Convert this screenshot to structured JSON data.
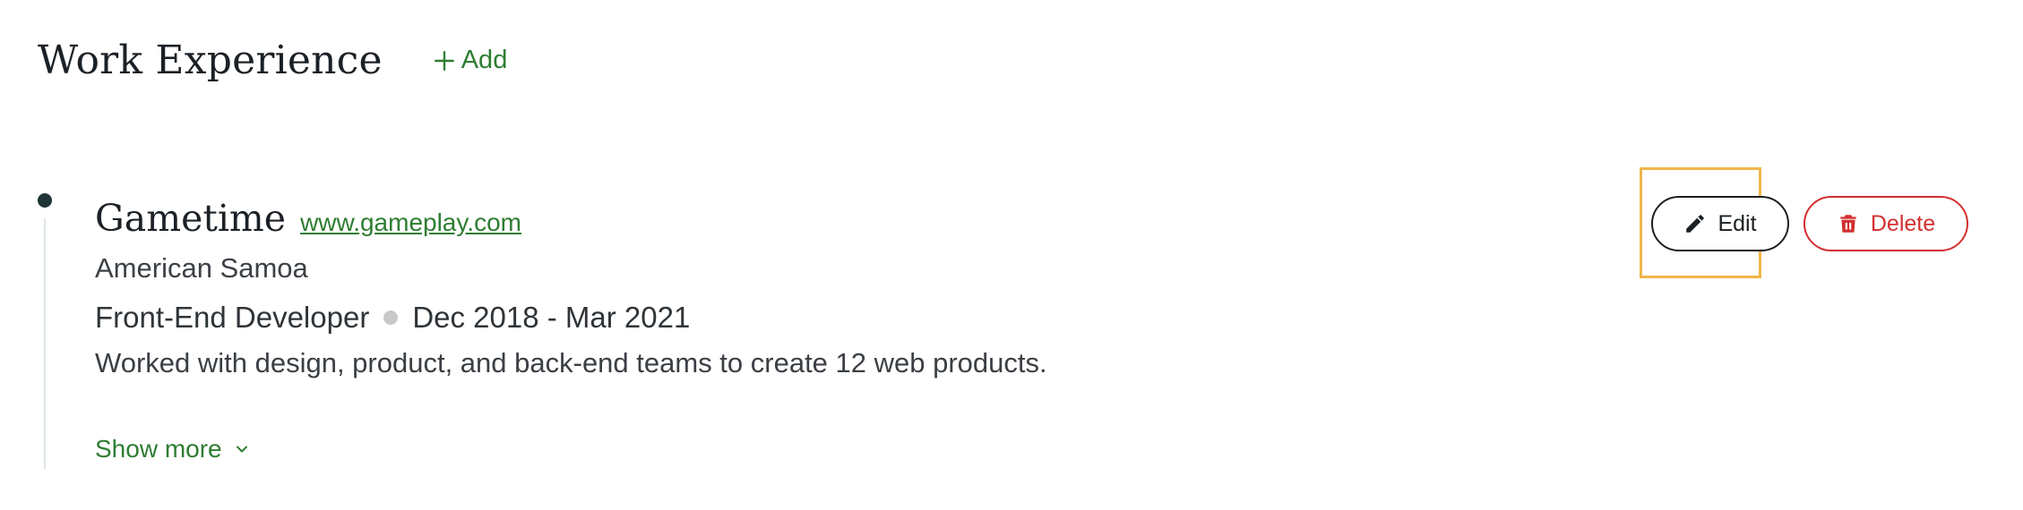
{
  "section": {
    "title": "Work Experience",
    "add_label": "Add"
  },
  "entry": {
    "company": "Gametime",
    "website": "www.gameplay.com",
    "location": "American Samoa",
    "role": "Front-End Developer",
    "dates": "Dec 2018 - Mar 2021",
    "description": "Worked with design, product, and back-end teams to create 12 web products.",
    "show_more_label": "Show more"
  },
  "actions": {
    "edit_label": "Edit",
    "delete_label": "Delete"
  },
  "icons": {
    "add": "plus-icon",
    "edit": "pencil-icon",
    "delete": "trash-icon",
    "show_more": "chevron-down-icon"
  },
  "colors": {
    "accent": "#2e7d32",
    "danger": "#d32f2f",
    "highlight": "#f0b64a",
    "title": "#1b2126"
  }
}
